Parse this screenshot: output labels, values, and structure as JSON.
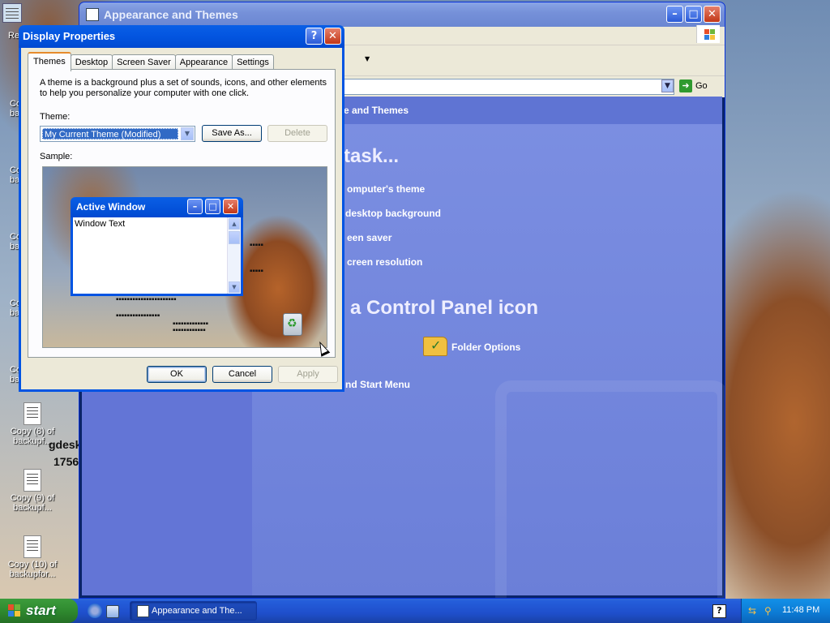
{
  "desktop": {
    "icons": [
      {
        "label": "Copy (8) of backupf..."
      },
      {
        "label": "Copy (9) of backupf..."
      },
      {
        "label": "Copy (10) of backupfor..."
      }
    ],
    "partial_labels": [
      "Re",
      "Co ba",
      "Co ba",
      "Co ba",
      "Co back",
      "Co ba"
    ],
    "overlay_text_1": "gdesk",
    "overlay_text_2": "1756"
  },
  "explorer": {
    "title": "Appearance and Themes",
    "address_go": "Go",
    "breadcrumb": "e and Themes",
    "pick_task_heading": "task...",
    "tasks": [
      "omputer's theme",
      "desktop background",
      "een saver",
      "creen resolution"
    ],
    "pick_icon_heading": "a Control Panel icon",
    "icons": [
      {
        "label": "Folder Options"
      }
    ],
    "start_menu_link": "nd Start Menu"
  },
  "dialog": {
    "title": "Display Properties",
    "help_glyph": "?",
    "close_glyph": "✕",
    "tabs": [
      "Themes",
      "Desktop",
      "Screen Saver",
      "Appearance",
      "Settings"
    ],
    "description": "A theme is a background plus a set of sounds, icons, and other elements to help you personalize your computer with one click.",
    "theme_label": "Theme:",
    "theme_value": "My Current Theme (Modified)",
    "save_as": "Save As...",
    "delete": "Delete",
    "sample_label": "Sample:",
    "sample_window_title": "Active Window",
    "sample_window_text": "Window Text",
    "ok": "OK",
    "cancel": "Cancel",
    "apply": "Apply"
  },
  "taskbar": {
    "start_label": "start",
    "task_button": "Appearance and The...",
    "help_glyph": "?",
    "clock": "11:48 PM"
  }
}
